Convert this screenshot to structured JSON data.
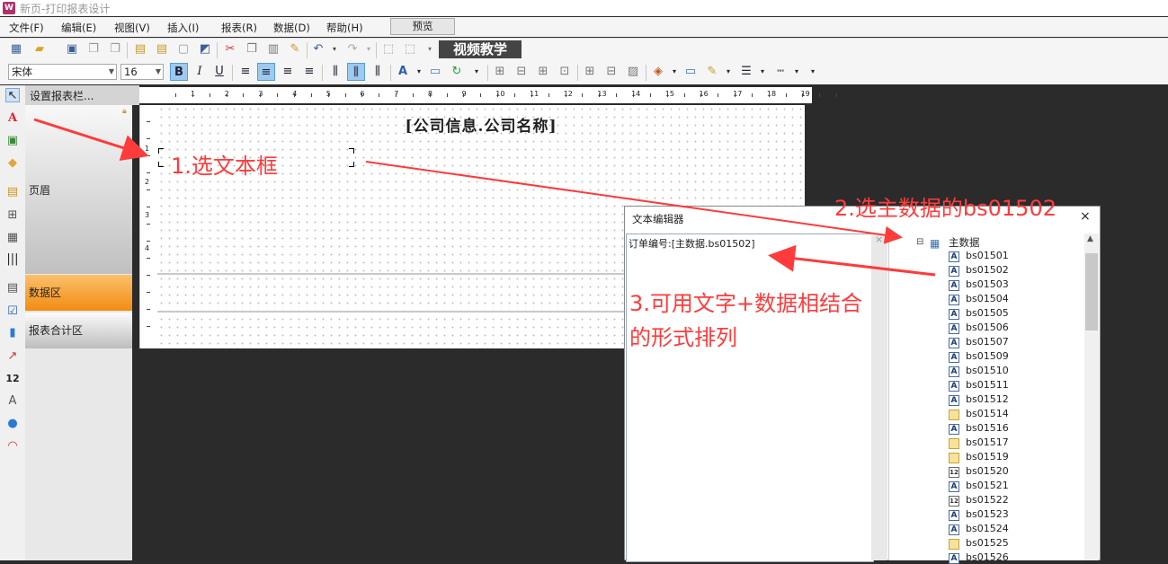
{
  "window": {
    "title": "新页-打印报表设计"
  },
  "menu": [
    "文件(F)",
    "编辑(E)",
    "视图(V)",
    "插入(I)",
    "报表(R)",
    "数据(D)",
    "帮助(H)"
  ],
  "preview_label": "预览",
  "video_label": "视频教学",
  "font": {
    "family": "宋体",
    "size": "16",
    "bold": "B",
    "italic": "I",
    "underline": "U"
  },
  "band_header": "设置报表栏...",
  "bands": {
    "header": "页眉",
    "data": "数据区",
    "summary": "报表合计区"
  },
  "ruler_h": [
    "1",
    "2",
    "3",
    "4",
    "5",
    "6",
    "7",
    "8",
    "9",
    "10",
    "11",
    "12",
    "13",
    "14",
    "15",
    "16",
    "17",
    "18",
    "19"
  ],
  "ruler_v": [
    "1",
    "2",
    "3",
    "4"
  ],
  "canvas": {
    "company_field": "[公司信息.公司名称]"
  },
  "dialog": {
    "title": "文本编辑器",
    "close": "×",
    "editor_text": "订单编号:[主数据.bs01502]",
    "tree_root": "主数据",
    "tree_items": [
      {
        "label": "bs01501",
        "type": "A"
      },
      {
        "label": "bs01502",
        "type": "A"
      },
      {
        "label": "bs01503",
        "type": "A"
      },
      {
        "label": "bs01504",
        "type": "A"
      },
      {
        "label": "bs01505",
        "type": "A"
      },
      {
        "label": "bs01506",
        "type": "A"
      },
      {
        "label": "bs01507",
        "type": "A"
      },
      {
        "label": "bs01509",
        "type": "A"
      },
      {
        "label": "bs01510",
        "type": "A"
      },
      {
        "label": "bs01511",
        "type": "A"
      },
      {
        "label": "bs01512",
        "type": "A"
      },
      {
        "label": "bs01514",
        "type": "img"
      },
      {
        "label": "bs01516",
        "type": "A"
      },
      {
        "label": "bs01517",
        "type": "img"
      },
      {
        "label": "bs01519",
        "type": "img"
      },
      {
        "label": "bs01520",
        "type": "12"
      },
      {
        "label": "bs01521",
        "type": "A"
      },
      {
        "label": "bs01522",
        "type": "12"
      },
      {
        "label": "bs01523",
        "type": "A"
      },
      {
        "label": "bs01524",
        "type": "A"
      },
      {
        "label": "bs01525",
        "type": "img"
      },
      {
        "label": "bs01526",
        "type": "A"
      }
    ]
  },
  "annotations": {
    "step1": "1.选文本框",
    "step2": "2.选主数据的bs01502",
    "step3_line1": "3.可用文字+数据相结合",
    "step3_line2": "的形式排列"
  },
  "colors": {
    "annotation": "#ff3b3b",
    "data_band": "#f28c12",
    "toolbar": "#f5f5f5"
  }
}
